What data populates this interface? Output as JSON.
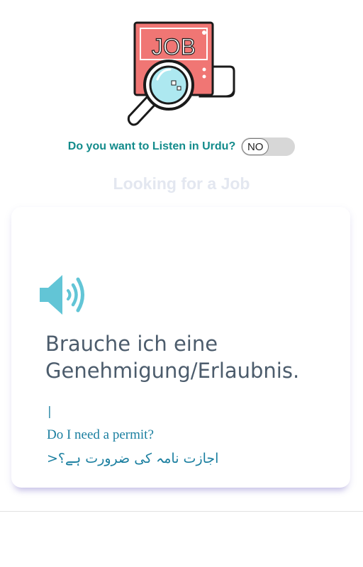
{
  "colors": {
    "accent_teal": "#128b8b",
    "text_blue": "#1b7fa0",
    "german_text": "#4c5c6c",
    "faded_title": "#e3e7f0",
    "logo_red": "#f07674",
    "speaker_blue": "#62c5d6"
  },
  "logo": {
    "text": "JOB",
    "icon": "job-search-magnifier-logo"
  },
  "settings": {
    "question": "Do you want to Listen in Urdu?",
    "toggle_label": "NO"
  },
  "section": {
    "title": "Looking for a Job"
  },
  "phrase": {
    "speaker_icon": "speaker-volume-icon",
    "german": "Brauche ich eine Genehmigung/Erlaubnis.",
    "cursor": "|",
    "english": "Do I need a permit?",
    "urdu": "اجازت نامہ کی ضرورت ہے؟<"
  }
}
